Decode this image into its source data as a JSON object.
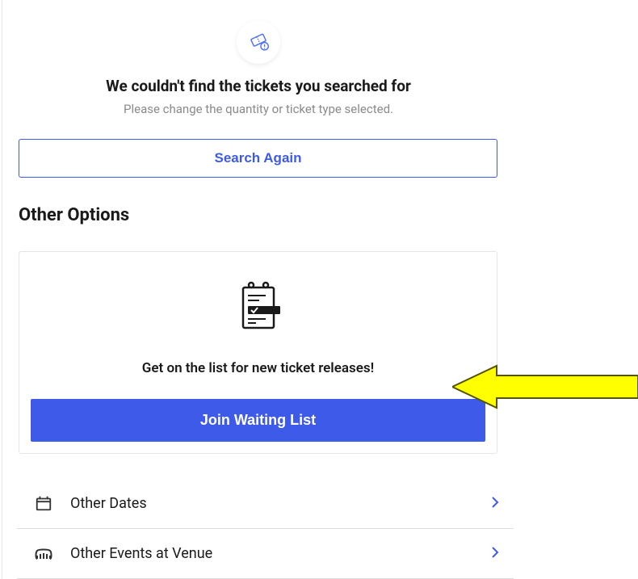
{
  "notice": {
    "heading": "We couldn't find the tickets you searched for",
    "subtext": "Please change the quantity or ticket type selected.",
    "search_button_label": "Search Again"
  },
  "other_options": {
    "title": "Other Options",
    "card": {
      "text": "Get on the list for new ticket releases!",
      "button_label": "Join Waiting List"
    }
  },
  "links": {
    "other_dates_label": "Other Dates",
    "other_events_label": "Other Events at Venue"
  }
}
